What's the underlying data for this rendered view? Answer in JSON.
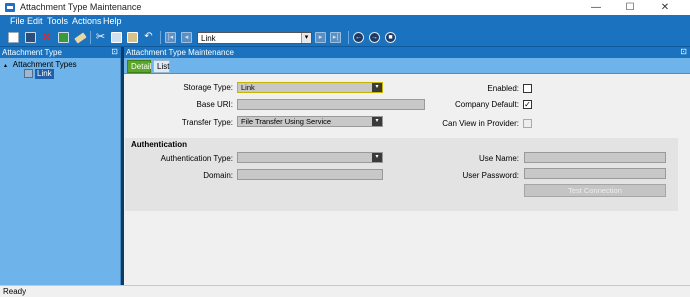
{
  "window": {
    "title": "Attachment Type Maintenance",
    "min": "—",
    "max": "☐",
    "close": "✕"
  },
  "menu": [
    "File",
    "Edit",
    "Tools",
    "Actions",
    "Help"
  ],
  "toolbar": {
    "record_value": "Link",
    "dropdown_arrow": "▾"
  },
  "tree": {
    "header": "Attachment Type",
    "pin": "⊡",
    "root": "Attachment Types",
    "expander": "▴",
    "item": "Link"
  },
  "detail": {
    "header": "Attachment Type Maintenance",
    "pin": "⊡",
    "tabs": {
      "detail": "Detail",
      "list": "List"
    },
    "storage_type": {
      "label": "Storage Type:",
      "value": "Link"
    },
    "base_uri": {
      "label": "Base URI:",
      "value": ""
    },
    "transfer_type": {
      "label": "Transfer Type:",
      "value": "File Transfer Using Service"
    },
    "enabled": {
      "label": "Enabled:",
      "checked": false
    },
    "company_default": {
      "label": "Company Default:",
      "checked": true,
      "mark": "✓"
    },
    "can_view_in_provider": {
      "label": "Can View in Provider:",
      "checked": false
    }
  },
  "authentication": {
    "title": "Authentication",
    "auth_type": {
      "label": "Authentication Type:",
      "value": ""
    },
    "domain": {
      "label": "Domain:",
      "value": ""
    },
    "use_name": {
      "label": "Use Name:",
      "value": ""
    },
    "user_password": {
      "label": "User Password:",
      "value": ""
    },
    "test_button": "Test Connection"
  },
  "status": {
    "text": "Ready"
  }
}
